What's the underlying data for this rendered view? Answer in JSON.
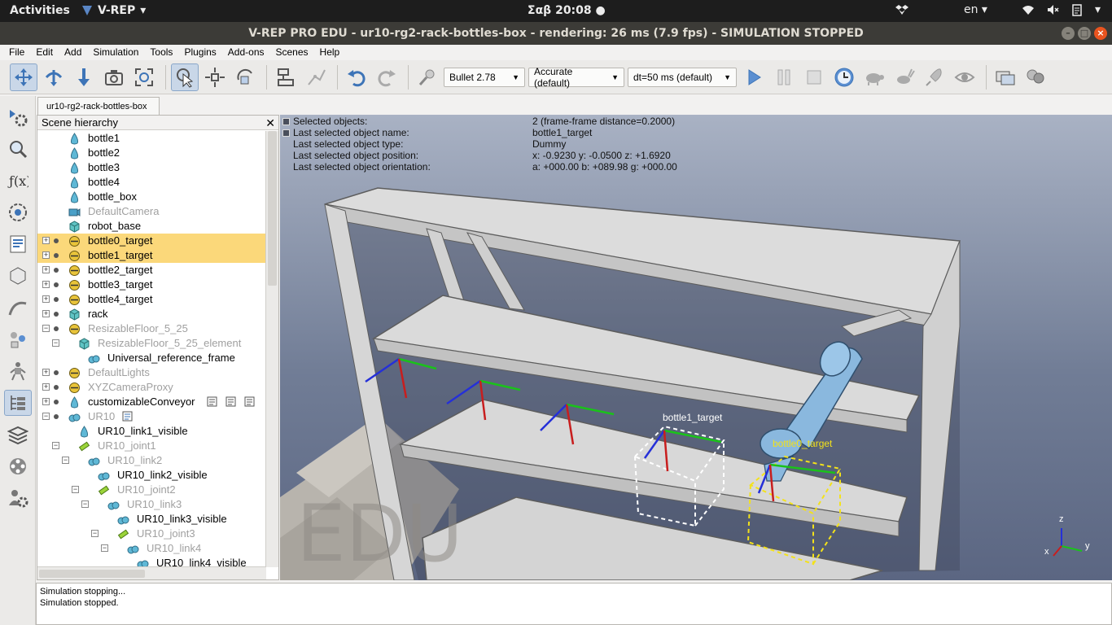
{
  "topbar": {
    "activities": "Activities",
    "app_name": "V-REP",
    "clock": "Σαβ 20:08",
    "lang": "en"
  },
  "window": {
    "title": "V-REP PRO EDU - ur10-rg2-rack-bottles-box - rendering: 26 ms (7.9 fps) - SIMULATION STOPPED"
  },
  "menu": [
    "File",
    "Edit",
    "Add",
    "Simulation",
    "Tools",
    "Plugins",
    "Add-ons",
    "Scenes",
    "Help"
  ],
  "toolbar": {
    "engine": "Bullet 2.78",
    "accuracy": "Accurate (default)",
    "timestep": "dt=50 ms (default)"
  },
  "scene_tab": "ur10-rg2-rack-bottles-box",
  "hierarchy": {
    "header": "Scene hierarchy",
    "rows": [
      {
        "label": "bottle1",
        "icon": "shape",
        "dim": false,
        "sel": false,
        "depth": 0
      },
      {
        "label": "bottle2",
        "icon": "shape",
        "dim": false,
        "sel": false,
        "depth": 0
      },
      {
        "label": "bottle3",
        "icon": "shape",
        "dim": false,
        "sel": false,
        "depth": 0
      },
      {
        "label": "bottle4",
        "icon": "shape",
        "dim": false,
        "sel": false,
        "depth": 0
      },
      {
        "label": "bottle_box",
        "icon": "shape",
        "dim": false,
        "sel": false,
        "depth": 0
      },
      {
        "label": "DefaultCamera",
        "icon": "camera",
        "dim": true,
        "sel": false,
        "depth": 0
      },
      {
        "label": "robot_base",
        "icon": "cube",
        "dim": false,
        "sel": false,
        "depth": 0
      },
      {
        "label": "bottle0_target",
        "icon": "dummy",
        "dim": false,
        "sel": true,
        "depth": 0
      },
      {
        "label": "bottle1_target",
        "icon": "dummy",
        "dim": false,
        "sel": true,
        "depth": 0
      },
      {
        "label": "bottle2_target",
        "icon": "dummy",
        "dim": false,
        "sel": false,
        "depth": 0
      },
      {
        "label": "bottle3_target",
        "icon": "dummy",
        "dim": false,
        "sel": false,
        "depth": 0
      },
      {
        "label": "bottle4_target",
        "icon": "dummy",
        "dim": false,
        "sel": false,
        "depth": 0
      },
      {
        "label": "rack",
        "icon": "cube",
        "dim": false,
        "sel": false,
        "depth": 0
      },
      {
        "label": "ResizableFloor_5_25",
        "icon": "dummy",
        "dim": true,
        "sel": false,
        "depth": 0
      },
      {
        "label": "ResizableFloor_5_25_element",
        "icon": "cube",
        "dim": true,
        "sel": false,
        "depth": 1
      },
      {
        "label": "Universal_reference_frame",
        "icon": "multishape",
        "dim": false,
        "sel": false,
        "depth": 2
      },
      {
        "label": "DefaultLights",
        "icon": "dummy",
        "dim": true,
        "sel": false,
        "depth": 0
      },
      {
        "label": "XYZCameraProxy",
        "icon": "dummy",
        "dim": true,
        "sel": false,
        "depth": 0
      },
      {
        "label": "customizableConveyor",
        "icon": "shape",
        "dim": false,
        "sel": false,
        "depth": 0
      },
      {
        "label": "UR10",
        "icon": "multishape",
        "dim": true,
        "sel": false,
        "depth": 0
      },
      {
        "label": "UR10_link1_visible",
        "icon": "shape",
        "dim": false,
        "sel": false,
        "depth": 1
      },
      {
        "label": "UR10_joint1",
        "icon": "joint",
        "dim": true,
        "sel": false,
        "depth": 1
      },
      {
        "label": "UR10_link2",
        "icon": "multishape",
        "dim": true,
        "sel": false,
        "depth": 2
      },
      {
        "label": "UR10_link2_visible",
        "icon": "multishape",
        "dim": false,
        "sel": false,
        "depth": 3
      },
      {
        "label": "UR10_joint2",
        "icon": "joint",
        "dim": true,
        "sel": false,
        "depth": 3
      },
      {
        "label": "UR10_link3",
        "icon": "multishape",
        "dim": true,
        "sel": false,
        "depth": 4
      },
      {
        "label": "UR10_link3_visible",
        "icon": "multishape",
        "dim": false,
        "sel": false,
        "depth": 5
      },
      {
        "label": "UR10_joint3",
        "icon": "joint",
        "dim": true,
        "sel": false,
        "depth": 5
      },
      {
        "label": "UR10_link4",
        "icon": "multishape",
        "dim": true,
        "sel": false,
        "depth": 6
      },
      {
        "label": "UR10_link4_visible",
        "icon": "multishape",
        "dim": false,
        "sel": false,
        "depth": 7
      }
    ]
  },
  "info": {
    "labels": [
      "Selected objects:",
      "Last selected object name:",
      "Last selected object type:",
      "Last selected object position:",
      "Last selected object orientation:"
    ],
    "values": [
      "2 (frame-frame distance=0.2000)",
      "bottle1_target",
      "Dummy",
      "x: -0.9230    y: -0.0500    z: +1.6920",
      "a: +000.00    b: +089.98    g: +000.00"
    ]
  },
  "scene_labels": {
    "bottle1": "bottle1_target",
    "bottle0": "bottle0_target",
    "watermark": "EDU",
    "axis_x": "x",
    "axis_y": "y",
    "axis_z": "z"
  },
  "status_lines": [
    "Simulation stopping...",
    "Simulation stopped."
  ]
}
